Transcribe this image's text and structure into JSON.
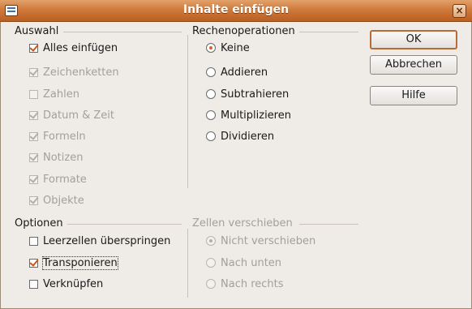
{
  "window": {
    "title": "Inhalte einfügen",
    "close_symbol": "×"
  },
  "auswahl": {
    "title": "Auswahl",
    "items": [
      {
        "label": "Alles einfügen",
        "checked": true,
        "disabled": false
      },
      {
        "label": "Zeichenketten",
        "checked": true,
        "disabled": true
      },
      {
        "label": "Zahlen",
        "checked": false,
        "disabled": true
      },
      {
        "label": "Datum & Zeit",
        "checked": true,
        "disabled": true
      },
      {
        "label": "Formeln",
        "checked": true,
        "disabled": true
      },
      {
        "label": "Notizen",
        "checked": true,
        "disabled": true
      },
      {
        "label": "Formate",
        "checked": true,
        "disabled": true
      },
      {
        "label": "Objekte",
        "checked": true,
        "disabled": true
      }
    ]
  },
  "rechenoperationen": {
    "title": "Rechenoperationen",
    "items": [
      {
        "label": "Keine",
        "selected": true
      },
      {
        "label": "Addieren",
        "selected": false
      },
      {
        "label": "Subtrahieren",
        "selected": false
      },
      {
        "label": "Multiplizieren",
        "selected": false
      },
      {
        "label": "Dividieren",
        "selected": false
      }
    ]
  },
  "optionen": {
    "title": "Optionen",
    "items": [
      {
        "label": "Leerzellen überspringen",
        "checked": false
      },
      {
        "label": "Transponieren",
        "checked": true
      },
      {
        "label": "Verknüpfen",
        "checked": false
      }
    ]
  },
  "zellen_verschieben": {
    "title": "Zellen verschieben",
    "items": [
      {
        "label": "Nicht verschieben",
        "selected": true
      },
      {
        "label": "Nach unten",
        "selected": false
      },
      {
        "label": "Nach rechts",
        "selected": false
      }
    ]
  },
  "buttons": {
    "ok": "OK",
    "abbrechen": "Abbrechen",
    "hilfe": "Hilfe"
  },
  "colors": {
    "titlebar": "#d07a3a",
    "accent": "#c8581a",
    "background": "#efebe7"
  }
}
